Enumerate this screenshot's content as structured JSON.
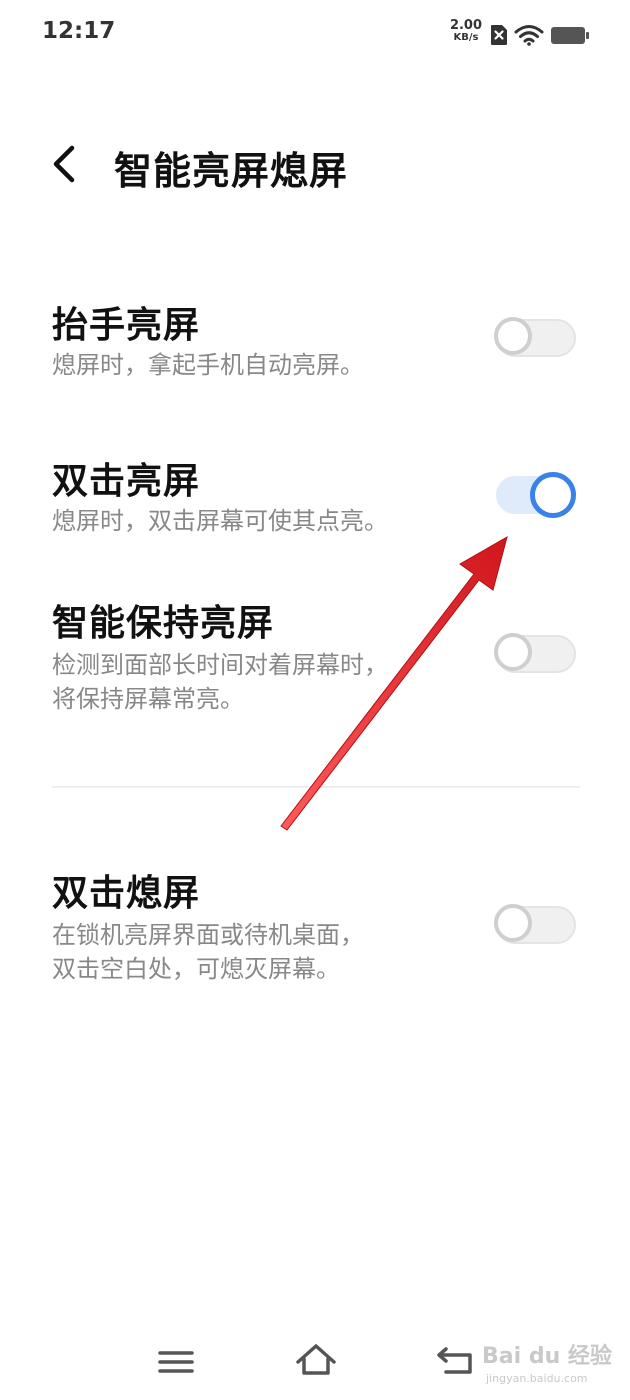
{
  "status_bar": {
    "time": "12:17",
    "net_speed_value": "2.00",
    "net_speed_unit": "KB/s",
    "icons": [
      "sim-error-icon",
      "wifi-icon",
      "battery-icon"
    ]
  },
  "header": {
    "back_icon": "chevron-left-icon",
    "title": "智能亮屏熄屏"
  },
  "settings": [
    {
      "title": "抬手亮屏",
      "desc_lines": [
        "熄屏时，拿起手机自动亮屏。"
      ],
      "enabled": false
    },
    {
      "title": "双击亮屏",
      "desc_lines": [
        "熄屏时，双击屏幕可使其点亮。"
      ],
      "enabled": true
    },
    {
      "title": "智能保持亮屏",
      "desc_lines": [
        "检测到面部长时间对着屏幕时，",
        "将保持屏幕常亮。"
      ],
      "enabled": false
    },
    {
      "title": "双击熄屏",
      "desc_lines": [
        "在锁机亮屏界面或待机桌面，",
        "双击空白处，可熄灭屏幕。"
      ],
      "enabled": false
    }
  ],
  "colors": {
    "accent": "#3b82e8",
    "annotation_arrow": "#e8262c"
  },
  "nav_bar": {
    "icons": [
      "menu-icon",
      "home-icon",
      "back-icon"
    ]
  },
  "watermark": {
    "brand": "Bai du 经验",
    "url": "jingyan.baidu.com"
  }
}
